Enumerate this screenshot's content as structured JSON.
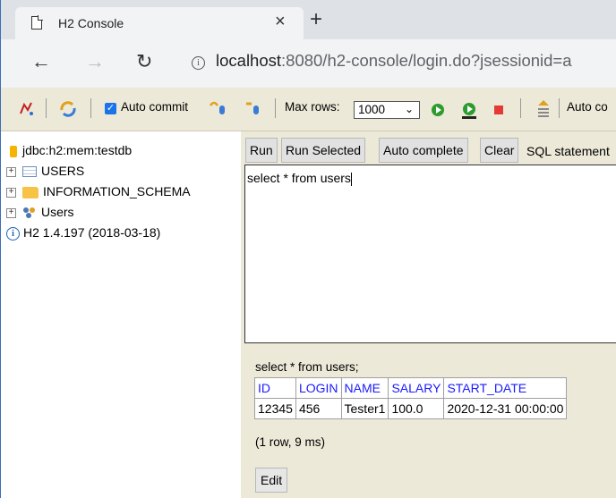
{
  "browser": {
    "tab_title": "H2 Console",
    "tab_close": "×",
    "new_tab": "+",
    "url_host": "localhost",
    "url_rest": ":8080/h2-console/login.do?jsessionid=a"
  },
  "toolbar": {
    "auto_commit_label": "Auto commit",
    "max_rows_label": "Max rows:",
    "max_rows_value": "1000",
    "auto_complete_label": "Auto co"
  },
  "tree": {
    "connection": "jdbc:h2:mem:testdb",
    "items": [
      {
        "label": "USERS"
      },
      {
        "label": "INFORMATION_SCHEMA"
      },
      {
        "label": "Users"
      }
    ],
    "version": "H2 1.4.197 (2018-03-18)"
  },
  "query": {
    "buttons": {
      "run": "Run",
      "run_selected": "Run Selected",
      "auto_complete": "Auto complete",
      "clear": "Clear"
    },
    "statement_label": "SQL statement",
    "sql_text": "select * from users"
  },
  "result": {
    "sql": "select * from users;",
    "columns": [
      "ID",
      "LOGIN",
      "NAME",
      "SALARY",
      "START_DATE"
    ],
    "rows": [
      [
        "12345",
        "456",
        "Tester1",
        "100.0",
        "2020-12-31 00:00:00"
      ]
    ],
    "row_info": "(1 row, 9 ms)",
    "edit_label": "Edit"
  }
}
